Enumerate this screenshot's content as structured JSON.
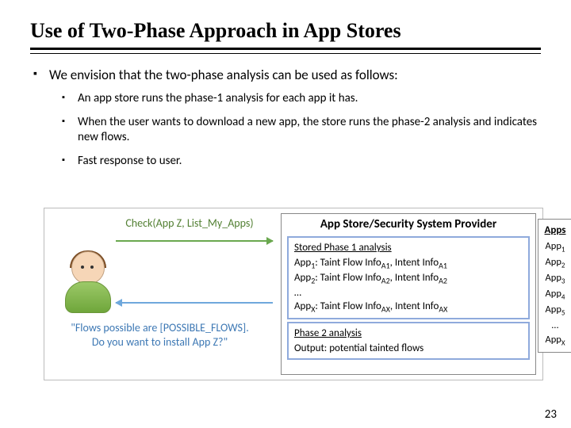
{
  "title": "Use of Two-Phase Approach in App Stores",
  "bullet_main": "We envision that the two-phase analysis can be used as follows:",
  "sub1": "An app store runs the phase-1 analysis for each app it has.",
  "sub2": "When the user wants to download a new app, the store runs the phase-2 analysis and indicates new flows.",
  "sub3": "Fast response to user.",
  "diagram": {
    "check_label": "Check(App Z, List_My_Apps)",
    "response": "\"Flows possible are [POSSIBLE_FLOWS].\nDo you want to install App Z?\"",
    "provider_title": "App Store/Security System Provider",
    "phase1_hdr": "Stored Phase 1 analysis",
    "p1_row1_a": "App",
    "p1_row1_s1": "1",
    "p1_row1_b": ": Taint Flow Info",
    "p1_row1_s2": "A1",
    "p1_row1_c": ", Intent Info",
    "p1_row1_s3": "A1",
    "p1_row2_a": "App",
    "p1_row2_s1": "2",
    "p1_row2_b": ": Taint Flow Info",
    "p1_row2_s2": "A2",
    "p1_row2_c": ", Intent Info",
    "p1_row2_s3": "A2",
    "p1_dots": "…",
    "p1_rowX_a": "App",
    "p1_rowX_s1": "X",
    "p1_rowX_b": ": Taint Flow Info",
    "p1_rowX_s2": "AX",
    "p1_rowX_c": ", Intent Info",
    "p1_rowX_s3": "AX",
    "phase2_hdr": "Phase 2 analysis",
    "phase2_out": "Output: potential tainted flows",
    "apps_hdr": "Apps",
    "apps": [
      "1",
      "2",
      "3",
      "4",
      "5"
    ],
    "apps_dots": "…",
    "apps_lastX": "X",
    "app_word": "App"
  },
  "page": "23"
}
